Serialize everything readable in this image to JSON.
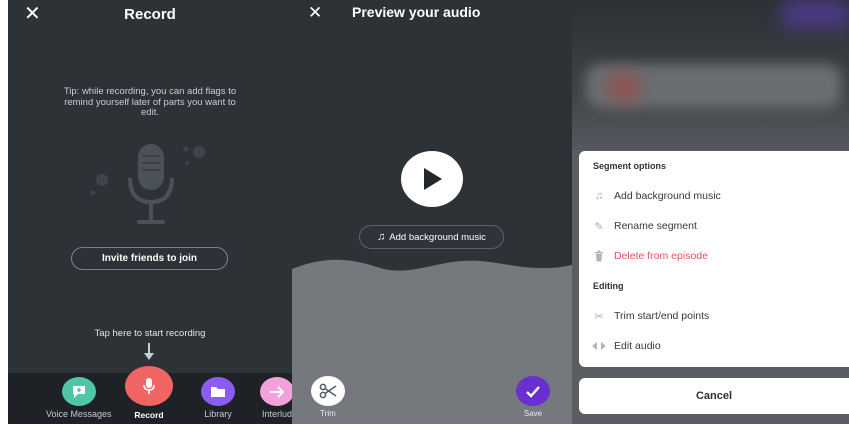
{
  "record_screen": {
    "title": "Record",
    "close_glyph": "✕",
    "tip": "Tip: while recording, you can add flags to remind yourself later of parts you want to edit.",
    "invite_label": "Invite friends to join",
    "start_hint": "Tap here to start recording",
    "nav": [
      {
        "label": "Voice Messages",
        "icon": "voice-message-icon",
        "color": "#4fc7a6"
      },
      {
        "label": "Record",
        "icon": "microphone-icon",
        "color": "#f06463"
      },
      {
        "label": "Library",
        "icon": "folder-icon",
        "color": "#8a5cf0"
      },
      {
        "label": "Interlud",
        "icon": "arrow-right-icon",
        "color": "#f3a1da"
      }
    ]
  },
  "preview_screen": {
    "title": "Preview your audio",
    "close_glyph": "✕",
    "add_music_label": "Add background music",
    "trim_label": "Trim",
    "save_label": "Save",
    "accent_color": "#6a2fd0"
  },
  "segment_sheet": {
    "section_segment": "Segment options",
    "section_editing": "Editing",
    "items": [
      {
        "label": "Add background music",
        "icon": "music-note-icon"
      },
      {
        "label": "Rename segment",
        "icon": "pencil-icon"
      },
      {
        "label": "Delete from episode",
        "icon": "trash-icon",
        "color": "#e4505c"
      },
      {
        "label": "Trim start/end points",
        "icon": "scissors-icon"
      },
      {
        "label": "Edit audio",
        "icon": "edit-audio-icon"
      }
    ],
    "cancel_label": "Cancel"
  }
}
